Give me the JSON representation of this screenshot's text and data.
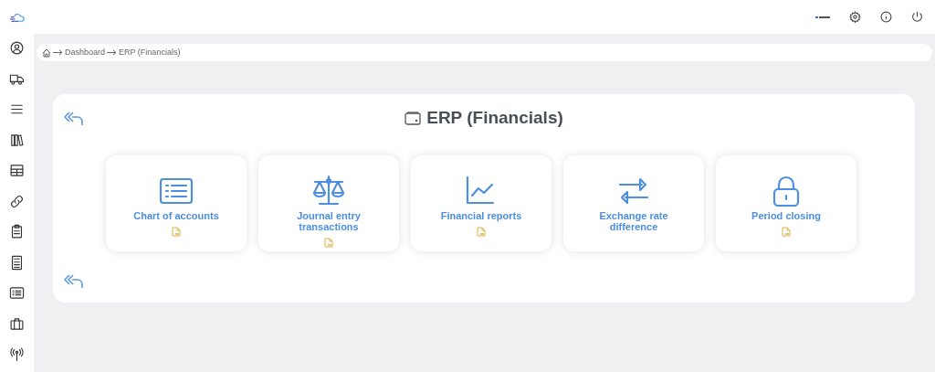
{
  "breadcrumb": [
    "Dashboard",
    "ERP (Financials)"
  ],
  "page_title": "ERP (Financials)",
  "cards": [
    {
      "label": "Chart of accounts",
      "pdf": true
    },
    {
      "label": "Journal entry transactions",
      "pdf": true
    },
    {
      "label": "Financial reports",
      "pdf": true
    },
    {
      "label": "Exchange rate difference",
      "pdf": false
    },
    {
      "label": "Period closing",
      "pdf": true
    }
  ]
}
